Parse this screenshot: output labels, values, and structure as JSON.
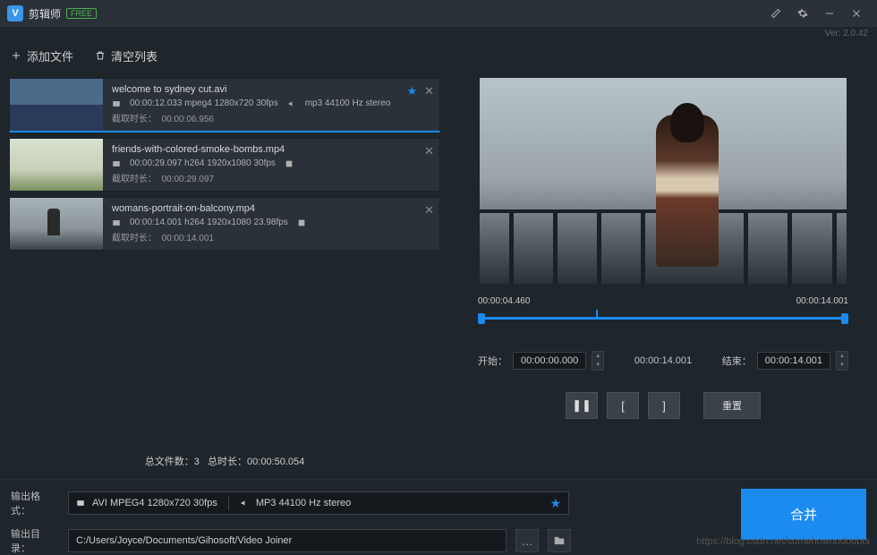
{
  "app": {
    "title": "剪辑师",
    "badge": "FREE",
    "version": "Ver: 2.0.42"
  },
  "toolbar": {
    "add_file": "添加文件",
    "clear_list": "清空列表"
  },
  "files": [
    {
      "name": "welcome to sydney cut.avi",
      "video_meta": "00:00:12.033 mpeg4 1280x720 30fps",
      "audio_meta": "mp3 44100 Hz stereo",
      "cut_label": "截取时长：",
      "cut_value": "00:00:06.956",
      "selected": true,
      "starred": true,
      "thumb": "city"
    },
    {
      "name": "friends-with-colored-smoke-bombs.mp4",
      "video_meta": "00:00:29.097 h264 1920x1080 30fps",
      "audio_meta": "",
      "cut_label": "截取时长：",
      "cut_value": "00:00:29.097",
      "selected": false,
      "starred": false,
      "thumb": "smoke"
    },
    {
      "name": "womans-portrait-on-balcony.mp4",
      "video_meta": "00:00:14.001 h264 1920x1080 23.98fps",
      "audio_meta": "",
      "cut_label": "截取时长：",
      "cut_value": "00:00:14.001",
      "selected": false,
      "starred": false,
      "thumb": "balcony"
    }
  ],
  "summary": {
    "count_label": "总文件数：",
    "count": "3",
    "dur_label": "总时长：",
    "dur": "00:00:50.054"
  },
  "preview": {
    "cur_time": "00:00:04.460",
    "end_time": "00:00:14.001",
    "start_label": "开始：",
    "start_value": "00:00:00.000",
    "mid_value": "00:00:14.001",
    "end_label": "结束：",
    "end_value": "00:00:14.001",
    "reset_label": "重置"
  },
  "output": {
    "format_label": "输出格式：",
    "video_format": "AVI MPEG4 1280x720 30fps",
    "audio_format": "MP3 44100 Hz stereo",
    "dir_label": "输出目录：",
    "dir_value": "C:/Users/Joyce/Documents/Gihosoft/Video Joiner",
    "merge_label": "合并"
  },
  "watermark": "https://blog.csdn.net/somehownodoubts"
}
